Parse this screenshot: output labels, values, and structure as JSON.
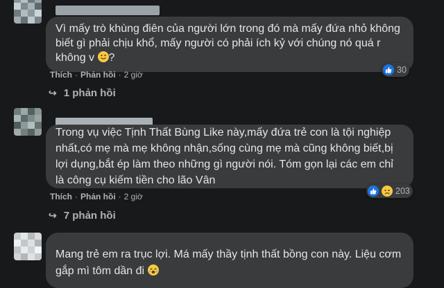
{
  "comments": [
    {
      "text": "Vì mấy trò khùng điên của người lớn trong đó mà mấy đứa nhỏ không biết gì phải chịu khổ, mấy người có phải ích kỷ với chúng nó quá r không v",
      "text_end": "?",
      "emoji": "slightly-smiling-face",
      "like_label": "Thích",
      "reply_label": "Phản hồi",
      "time": "2 giờ",
      "reaction": "like-icon",
      "reaction_count": "30",
      "replies_label": "1 phản hồi"
    },
    {
      "text": "Trong vụ việc Tịnh Thất Bùng Like này,mấy đứa trẻ con là tội nghiệp nhất,có mẹ mà mẹ không nhận,sống cùng mẹ mà cũng không biết,bị lợi dụng,bắt ép làm theo những gì người nói. Tóm gọn lại các em chỉ là công cụ kiếm tiền cho lão Vân",
      "like_label": "Thích",
      "reply_label": "Phản hồi",
      "time": "2 giờ",
      "reactions": [
        "like-icon",
        "sad-icon"
      ],
      "reaction_count": "203",
      "replies_label": "7 phản hồi"
    },
    {
      "text": "Mang trẻ em ra trục lợi. Má mấy thầy tịnh thất bồng con này. Liệu cơm gắp mì tôm dần đi",
      "emoji": "face-with-tears"
    }
  ],
  "colors": {
    "background": "#18191a",
    "bubble": "#3a3b3c",
    "text": "#e4e6eb",
    "secondary": "#b0b3b8",
    "like_blue": "#1b74e4",
    "sad_yellow": "#f7c842"
  }
}
